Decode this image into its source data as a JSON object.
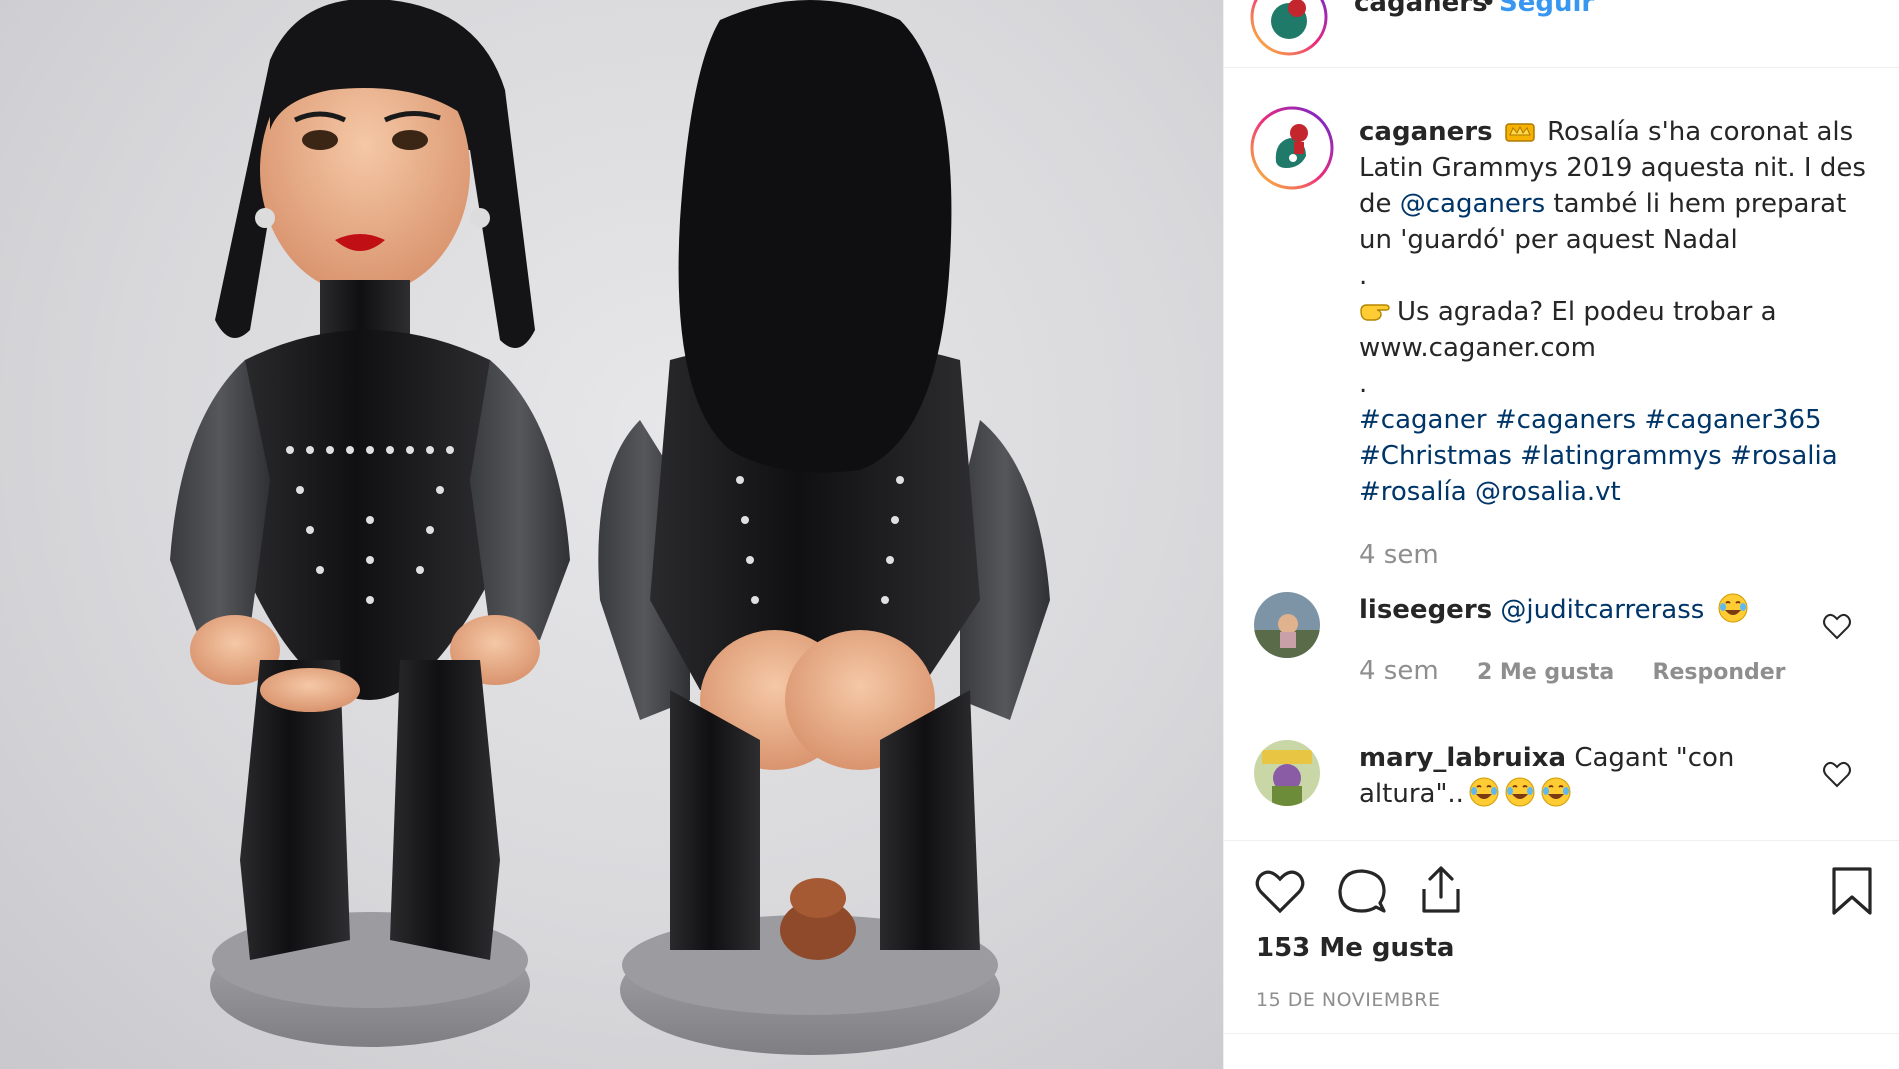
{
  "post": {
    "username": "caganers",
    "follow_separator": "•",
    "follow_label": "Seguir"
  },
  "caption": {
    "username": "caganers",
    "line1": "Rosalía s'ha coronat als Latin Grammys 2019 aquesta nit. I des de",
    "mention": "@caganers",
    "line1b": "també li hem preparat un 'guardó' per aquest Nadal",
    "dot1": ".",
    "line2": "Us agrada? El podeu trobar a www.caganer.com",
    "dot2": ".",
    "hashtags": [
      "#caganer",
      "#caganers",
      "#caganer365",
      "#Christmas",
      "#latingrammys",
      "#rosalia",
      "#rosalía"
    ],
    "tail_mention": "@rosalia.vt",
    "time": "4 sem"
  },
  "comments": [
    {
      "username": "liseegers",
      "text_mention": "@juditcarrerass",
      "time": "4 sem",
      "likes": "2 Me gusta",
      "reply": "Responder"
    },
    {
      "username": "mary_labruixa",
      "text": "Cagant \"con altura\".."
    }
  ],
  "footer": {
    "likes": "153 Me gusta",
    "date": "15 DE NOVIEMBRE"
  },
  "icons": {
    "like": "heart-icon",
    "comment": "comment-icon",
    "share": "share-icon",
    "save": "bookmark-icon",
    "emoji": "laughing-tears-emoji",
    "crown": "crown-emoji",
    "pointing": "pointing-hand-emoji"
  },
  "colors": {
    "link": "#003569",
    "follow": "#3897f0",
    "muted": "#8e8e8e",
    "text": "#262626"
  }
}
